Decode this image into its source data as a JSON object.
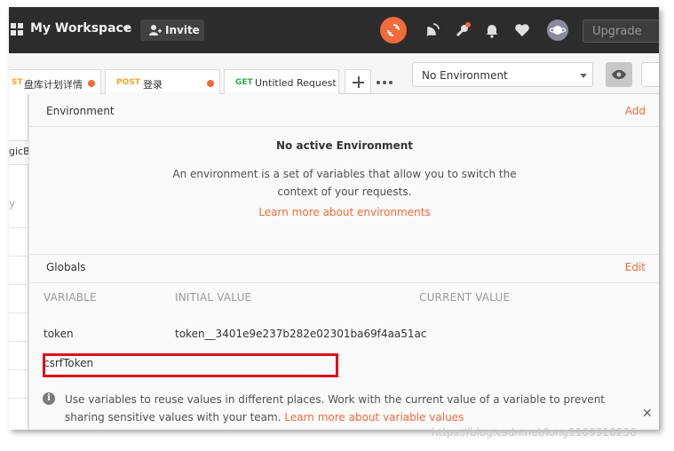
{
  "topbar": {
    "workspace_title": "My Workspace",
    "invite_label": "Invite",
    "upgrade_label": "Upgrade",
    "icons": [
      "grid-icon",
      "user-plus-icon",
      "sync-icon",
      "satellite-icon",
      "wrench-icon",
      "bell-icon",
      "heart-icon",
      "avatar"
    ]
  },
  "tabs": [
    {
      "method": "ST",
      "name": "盘库计划详情",
      "method_color": "#f5a623",
      "unsaved": true
    },
    {
      "method": "POST",
      "name": "登录",
      "method_color": "#f5a623",
      "unsaved": true
    },
    {
      "method": "GET",
      "name": "Untitled Request",
      "method_color": "#2fa84f",
      "unsaved": false
    }
  ],
  "environment_selector": {
    "selected": "No Environment"
  },
  "left_strip": {
    "text": "gicB",
    "faded": "y"
  },
  "env_panel": {
    "environment_title": "Environment",
    "environment_action": "Add",
    "no_active": "No active Environment",
    "description_line1": "An environment is a set of variables that allow you to switch the",
    "description_line2": "context of your requests.",
    "learn_more": "Learn more about environments",
    "globals_title": "Globals",
    "globals_action": "Edit",
    "columns": [
      "VARIABLE",
      "INITIAL VALUE",
      "CURRENT VALUE"
    ],
    "rows": [
      {
        "variable": "token",
        "initial": "token__3401e9e237b282e02301ba69f4aa51ac",
        "current": ""
      },
      {
        "variable": "csrfToken",
        "initial": "",
        "current": ""
      }
    ],
    "info_text": "Use variables to reuse values in different places. Work with the current value of a variable to prevent sharing sensitive values with your team.",
    "info_link": "Learn more about variable values"
  },
  "watermark": "https://blog.csdn.net/long1109910236",
  "colors": {
    "accent": "#f26b3a",
    "highlight": "#e0101a",
    "topbar": "#2c2c2c"
  }
}
